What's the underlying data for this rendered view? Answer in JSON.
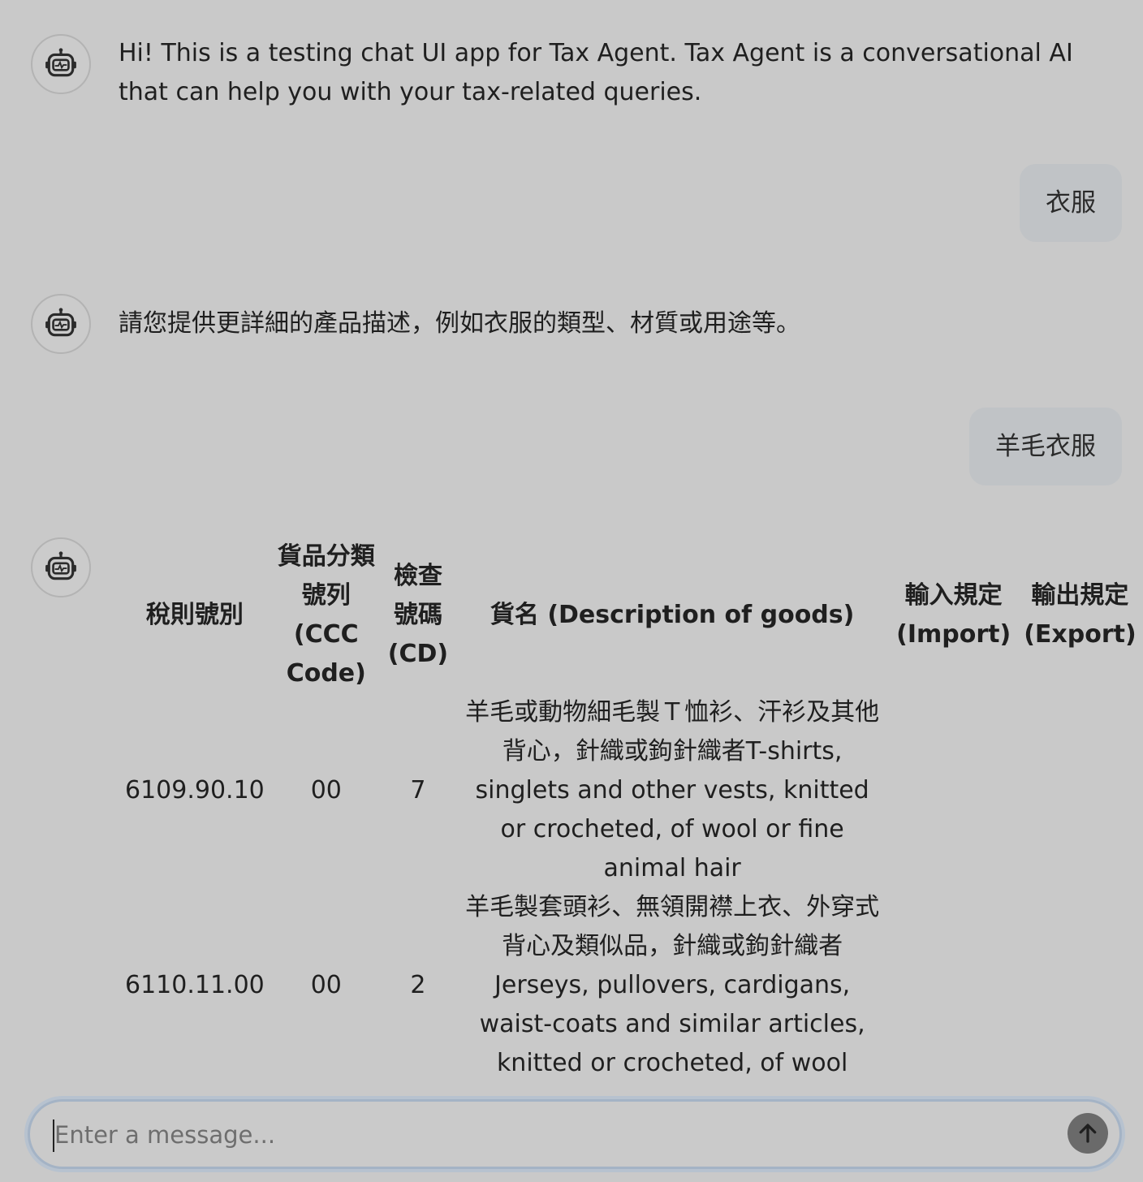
{
  "messages": [
    {
      "role": "assistant",
      "text": "Hi! This is a testing chat UI app for Tax Agent. Tax Agent is a conversational AI that can help you with your tax-related queries."
    },
    {
      "role": "user",
      "text": "衣服"
    },
    {
      "role": "assistant",
      "text": "請您提供更詳細的產品描述，例如衣服的類型、材質或用途等。"
    },
    {
      "role": "user",
      "text": "羊毛衣服"
    }
  ],
  "table": {
    "headers": [
      "稅則號別",
      "貨品分類號列 (CCC Code)",
      "檢查號碼 (CD)",
      "貨名 (Description of goods)",
      "輸入規定 (Import)",
      "輸出規定 (Export)"
    ],
    "rows": [
      [
        "6109.90.10",
        "00",
        "7",
        "羊毛或動物細毛製Ｔ恤衫、汗衫及其他背心，針織或鉤針織者T-shirts, singlets and other vests, knitted or crocheted, of wool or fine animal hair",
        "",
        ""
      ],
      [
        "6110.11.00",
        "00",
        "2",
        "羊毛製套頭衫、無領開襟上衣、外穿式背心及類似品，針織或鉤針織者Jerseys, pullovers, cardigans, waist-coats and similar articles, knitted or crocheted, of wool",
        "",
        ""
      ]
    ]
  },
  "composer": {
    "placeholder": "Enter a message..."
  },
  "icons": {
    "avatar": "robot-icon",
    "send": "arrow-up-icon"
  }
}
